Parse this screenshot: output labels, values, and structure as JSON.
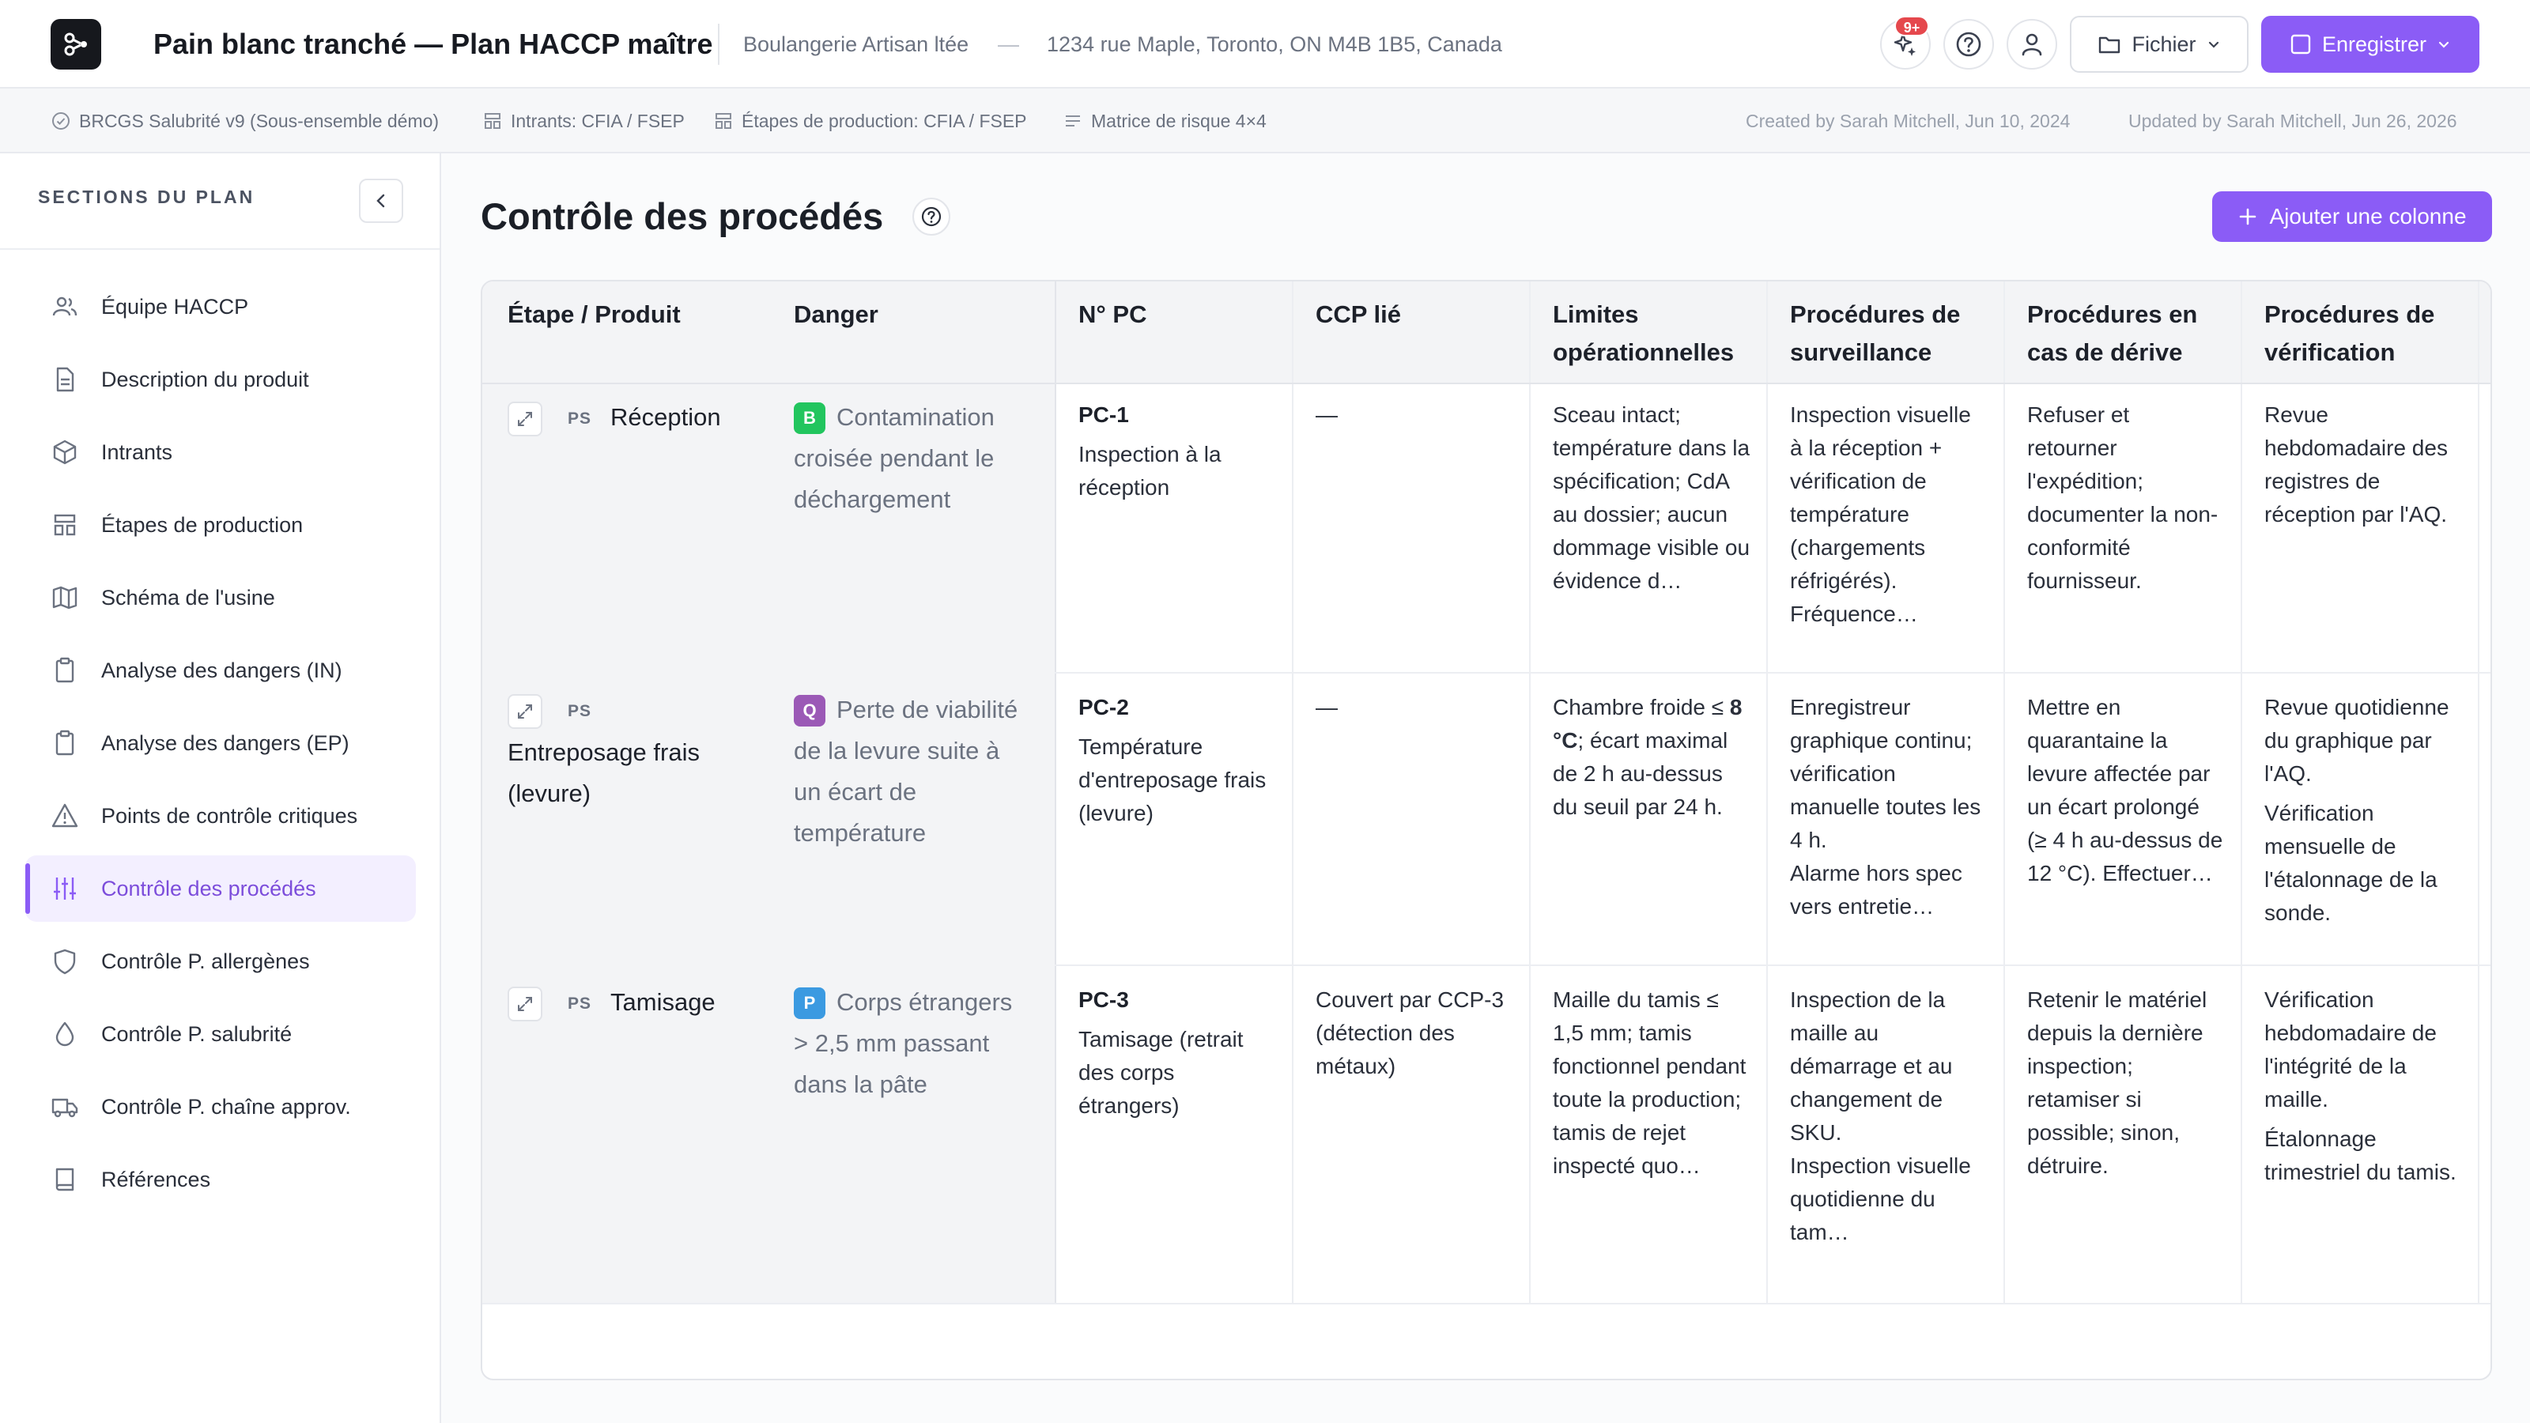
{
  "header": {
    "title": "Pain blanc tranché — Plan HACCP maître",
    "company": "Boulangerie Artisan ltée",
    "separator": "—",
    "address": "1234 rue Maple, Toronto, ON M4B 1B5, Canada",
    "notifications_badge": "9+",
    "file_button": "Fichier",
    "save_button": "Enregistrer",
    "icons": [
      "sparkle-icon",
      "help-icon",
      "user-icon",
      "folder-icon",
      "save-icon",
      "chevron-down-icon"
    ]
  },
  "metabar": {
    "standard": "BRCGS Salubrité v9 (Sous-ensemble démo)",
    "inputs": "Intrants: CFIA / FSEP",
    "steps": "Étapes de production: CFIA / FSEP",
    "risk": "Matrice de risque 4×4",
    "created": "Created by Sarah Mitchell, Jun 10, 2024",
    "updated": "Updated by Sarah Mitchell, Jun 26, 2026"
  },
  "sidebar": {
    "heading": "SECTIONS DU PLAN",
    "items": [
      {
        "label": "Équipe HACCP",
        "icon": "users-icon"
      },
      {
        "label": "Description du produit",
        "icon": "document-icon"
      },
      {
        "label": "Intrants",
        "icon": "box-icon"
      },
      {
        "label": "Étapes de production",
        "icon": "layout-icon"
      },
      {
        "label": "Schéma de l'usine",
        "icon": "map-icon"
      },
      {
        "label": "Analyse des dangers (IN)",
        "icon": "clipboard-icon"
      },
      {
        "label": "Analyse des dangers (EP)",
        "icon": "clipboard-icon"
      },
      {
        "label": "Points de contrôle critiques",
        "icon": "warning-icon"
      },
      {
        "label": "Contrôle des procédés",
        "icon": "sliders-icon",
        "active": true
      },
      {
        "label": "Contrôle P. allergènes",
        "icon": "shield-icon"
      },
      {
        "label": "Contrôle P. salubrité",
        "icon": "drop-icon"
      },
      {
        "label": "Contrôle P. chaîne approv.",
        "icon": "truck-icon"
      },
      {
        "label": "Références",
        "icon": "book-icon"
      }
    ]
  },
  "main": {
    "title": "Contrôle des procédés",
    "add_column": "Ajouter une colonne",
    "columns": [
      "Étape / Produit",
      "Danger",
      "N° PC",
      "CCP lié",
      "Limites opérationnelles",
      "Procédures de surveillance",
      "Procédures en cas de dérive",
      "Procédures de vérification"
    ],
    "rows": [
      {
        "tag": "PS",
        "step": "Réception",
        "danger_badge": "B",
        "danger": "Contamination croisée pendant le déchargement",
        "pc": "PC-1",
        "pc_desc": "Inspection à la réception",
        "ccp": "—",
        "limits": "Sceau intact; température dans la spécification; CdA au dossier; aucun dommage visible ou évidence d…",
        "monitoring": "Inspection visuelle à la réception + vérification de température (chargements réfrigérés). Fréquence…",
        "deviation": "Refuser et retourner l'expédition; documenter la non-conformité fournisseur.",
        "verification": "Revue hebdomadaire des registres de réception par l'AQ."
      },
      {
        "tag": "PS",
        "step": "Entreposage frais (levure)",
        "danger_badge": "Q",
        "danger": "Perte de viabilité de la levure suite à un écart de température",
        "pc": "PC-2",
        "pc_desc": "Température d'entreposage frais (levure)",
        "ccp": "—",
        "limits_pre": "Chambre froide ≤",
        "limits_bold": "8 °C",
        "limits_post": "; écart maximal de 2 h au-dessus du seuil par 24 h.",
        "monitoring": "Enregistreur graphique continu; vérification manuelle toutes les 4 h.",
        "monitoring_2": "Alarme hors spec vers entretie…",
        "deviation": "Mettre en quarantaine la levure affectée par un écart prolongé (≥ 4 h au-dessus de 12 °C). Effectuer…",
        "verification": "Revue quotidienne du graphique par l'AQ.",
        "verification_2": "Vérification mensuelle de l'étalonnage de la sonde."
      },
      {
        "tag": "PS",
        "step": "Tamisage",
        "danger_badge": "P",
        "danger": "Corps étrangers > 2,5 mm passant dans la pâte",
        "pc": "PC-3",
        "pc_desc": "Tamisage (retrait des corps étrangers)",
        "ccp": "Couvert par CCP-3 (détection des métaux)",
        "limits": "Maille du tamis ≤ 1,5 mm; tamis fonctionnel pendant toute la production; tamis de rejet inspecté quo…",
        "monitoring": "Inspection de la maille au démarrage et au changement de SKU.",
        "monitoring_2": "Inspection visuelle quotidienne du tam…",
        "deviation": "Retenir le matériel depuis la dernière inspection; retamiser si possible; sinon, détruire.",
        "verification": "Vérification hebdomadaire de l'intégrité de la maille.",
        "verification_2": "Étalonnage trimestriel du tamis."
      }
    ]
  },
  "colors": {
    "accent": "#8b5cf6",
    "badge_b": "#22c55e",
    "badge_q": "#9b59b6",
    "badge_p": "#3b9ae1",
    "notif": "#e5484d"
  }
}
